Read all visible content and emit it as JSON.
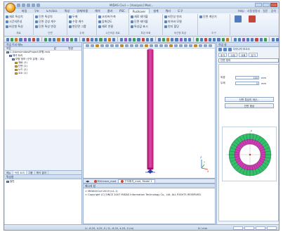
{
  "window": {
    "title": "MIDAS Civil — [Analysis] Mod..."
  },
  "ribbon": {
    "tabs": [
      "파일",
      "구조",
      "노드/요소",
      "특성",
      "경계/하중",
      "해석",
      "결과",
      "PSC",
      "Pushover",
      "설계",
      "쿼리",
      "도구"
    ],
    "active_tab_index": 8,
    "right_items": [
      "Help",
      "사용설명서",
      "질문",
      "검색"
    ],
    "groups": [
      {
        "name": "재료",
        "cmds": [
          "재료 특성치",
          "시간의존성",
          "비선형 특성"
        ]
      },
      {
        "name": "단면",
        "cmds": [
          "단면 특성치",
          "단면 강성 계수",
          "단면 특성 변경"
        ]
      },
      {
        "name": "두께",
        "cmds": [
          "두께",
          "수정 계수",
          "변단면 그룹"
        ]
      },
      {
        "name": "시간의존 재료",
        "cmds": [
          "크리프/수축",
          "압축강도",
          "재료 연결"
        ]
      },
      {
        "name": "특성 조회",
        "cmds": [
          "재료 테이블",
          "단면 테이블",
          "특성값 표시"
        ]
      },
      {
        "name": "비선형 특성",
        "cmds": [
          "비탄성 힌지",
          "파이버 모델",
          "힌지 할당"
        ]
      },
      {
        "name": "도구",
        "cmds": [
          "단면 계산기"
        ]
      }
    ]
  },
  "tree_panel": {
    "header": "작업 트리 메뉴",
    "columns": [
      "작업",
      "값",
      "변경"
    ],
    "rows": [
      {
        "label": "C:\\Users\\midas\\Project\\모형.mcb",
        "indent": 0,
        "kind": "b"
      },
      {
        "label": "해석 트리",
        "indent": 1,
        "kind": "b"
      },
      {
        "label": "모형 정보 (구조 유형 : 3D)",
        "indent": 2,
        "kind": "b"
      },
      {
        "label": "재료 (1)",
        "indent": 3,
        "kind": "f"
      },
      {
        "label": "단면 (1)",
        "indent": 3,
        "kind": "f"
      },
      {
        "label": "노드 (2)",
        "indent": 3,
        "kind": "f"
      },
      {
        "label": "요소 (1)",
        "indent": 3,
        "kind": "f"
      }
    ],
    "bottom_tabs": [
      "메뉴",
      "작업 트리",
      "그룹",
      "해석 결과"
    ],
    "active_bottom_tab": 1
  },
  "properties_panel": {
    "header": "특성창",
    "item": "일반"
  },
  "viewport": {
    "axis_labels": [
      "X",
      "Y",
      "Z"
    ]
  },
  "doc_tabs": [
    {
      "label": "MVLtrace_mod",
      "active": false
    },
    {
      "label": "구조해석_mod, Model 1",
      "active": true
    }
  ],
  "output": {
    "header": "메시지 창",
    "lines": [
      "> MIDAS/Civil 2019 (v1.1)",
      "> Copyright (C) SINCE 2007 MIDAS Information Technology Co., Ltd. ALL RIGHTS RESERVED."
    ]
  },
  "right_panel": {
    "header": "작업 창",
    "toolbar_label": "다이나믹 보고서",
    "buttons": [
      "추가",
      "수정",
      "삭제",
      "닫기"
    ],
    "selected": "단면 정의",
    "fields": [
      {
        "label": "외경",
        "value": "100",
        "unit": "mm"
      },
      {
        "label": "두께",
        "value": "5",
        "unit": "mm"
      }
    ],
    "actions": [
      "단면 특성치 계산...",
      "단면 형상"
    ],
    "section_label": "y"
  },
  "statusbar": {
    "coords": "U: -6.25, 4.25, 0 / G: -6.25, 4.25, 0 (m)",
    "units": "N / mm"
  },
  "colors": {
    "member": "#c0177e",
    "ring_outer": "#33c26b",
    "ring_inner": "#d23bb8"
  }
}
